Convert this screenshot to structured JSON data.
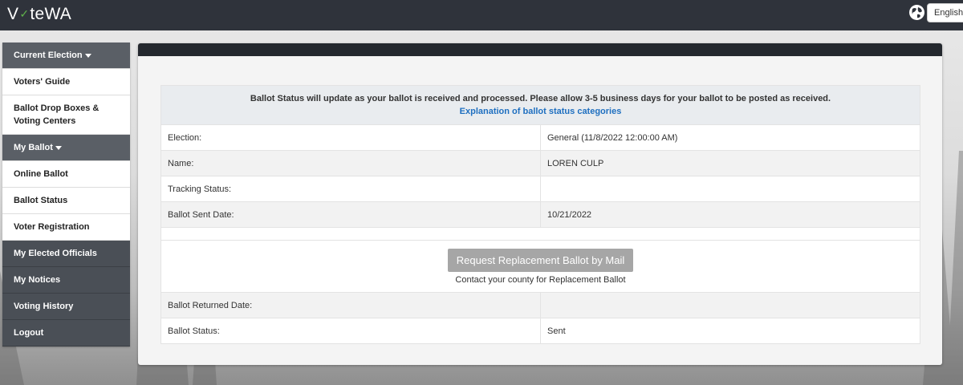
{
  "app": {
    "logo": "VoteWA",
    "language": "English"
  },
  "sidebar": {
    "items": [
      {
        "label": "Current Election",
        "style": "header",
        "caret": true
      },
      {
        "label": "Voters' Guide",
        "style": "light"
      },
      {
        "label": "Ballot Drop Boxes & Voting Centers",
        "style": "light"
      },
      {
        "label": "My Ballot",
        "style": "header",
        "caret": true
      },
      {
        "label": "Online Ballot",
        "style": "light"
      },
      {
        "label": "Ballot Status",
        "style": "light"
      },
      {
        "label": "Voter Registration",
        "style": "light"
      },
      {
        "label": "My Elected Officials",
        "style": "dark"
      },
      {
        "label": "My Notices",
        "style": "dark"
      },
      {
        "label": "Voting History",
        "style": "dark"
      },
      {
        "label": "Logout",
        "style": "dark"
      }
    ]
  },
  "status": {
    "notice": "Ballot Status will update as your ballot is received and processed. Please allow 3-5 business days for your ballot to be posted as received.",
    "notice_link": "Explanation of ballot status categories",
    "rows_top": [
      {
        "label": "Election:",
        "value": "General (11/8/2022 12:00:00 AM)"
      },
      {
        "label": "Name:",
        "value": "LOREN CULP"
      },
      {
        "label": "Tracking Status:",
        "value": ""
      },
      {
        "label": "Ballot Sent Date:",
        "value": "10/21/2022"
      }
    ],
    "replace_button": "Request Replacement Ballot by Mail",
    "replace_note": "Contact your county for Replacement Ballot",
    "rows_bottom": [
      {
        "label": "Ballot Returned Date:",
        "value": ""
      },
      {
        "label": "Ballot Status:",
        "value": "Sent"
      }
    ]
  },
  "colors": {
    "topbar": "#2f333b",
    "sidebar_dark": "#4a4f56",
    "link": "#1e6fc0",
    "logo_check": "#5fb14b",
    "button_disabled": "#a6a6a6"
  },
  "icons": {
    "globe": "globe-icon",
    "caret": "caret-down-icon",
    "logo_check": "checkmark-icon"
  }
}
